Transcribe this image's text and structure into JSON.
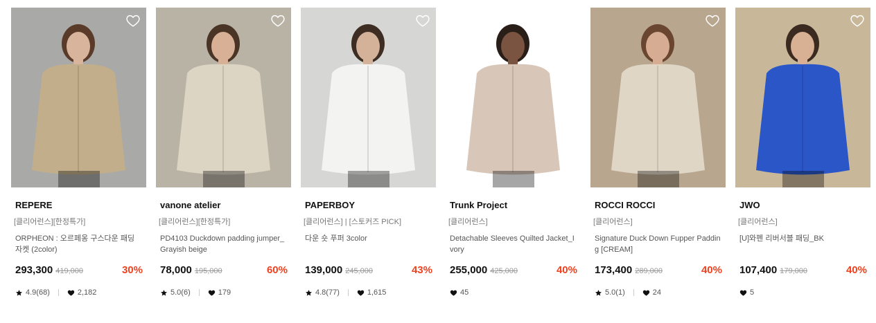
{
  "products": [
    {
      "brand": "REPERE",
      "tags": "[클리어런스][한정특가]",
      "name": "ORPHEON : 오르페옹 구스다운 패딩 자켓 (2color)",
      "price": "293,300",
      "original_price": "419,000",
      "discount": "30%",
      "rating": "4.9(68)",
      "likes": "2,182",
      "photo_colors": {
        "bg": "#a9a9a7",
        "coat": "#c2ae8a",
        "skin": "#d8b49c",
        "hair": "#5a3a28"
      }
    },
    {
      "brand": "vanone atelier",
      "tags": "[클리어런스][한정특가]",
      "name": "PD4103 Duckdown padding jumper_Grayish beige",
      "price": "78,000",
      "original_price": "195,000",
      "discount": "60%",
      "rating": "5.0(6)",
      "likes": "179",
      "photo_colors": {
        "bg": "#b9b3a6",
        "coat": "#dcd5c4",
        "skin": "#d7b096",
        "hair": "#4a3426"
      }
    },
    {
      "brand": "PAPERBOY",
      "tags": "[클리어런스] | [스토커즈 PICK]",
      "name": "다운 숏 푸퍼 3color",
      "price": "139,000",
      "original_price": "245,000",
      "discount": "43%",
      "rating": "4.8(77)",
      "likes": "1,615",
      "photo_colors": {
        "bg": "#d6d6d4",
        "coat": "#f3f3f1",
        "skin": "#d4b29a",
        "hair": "#3d2d22"
      }
    },
    {
      "brand": "Trunk Project",
      "tags": "[클리어런스]",
      "name": "Detachable Sleeves Quilted Jacket_Ivory",
      "price": "255,000",
      "original_price": "425,000",
      "discount": "40%",
      "rating": "",
      "likes": "45",
      "photo_colors": {
        "bg": "#ffffff",
        "coat": "#d8c6b8",
        "skin": "#7a5440",
        "hair": "#2a1e18"
      }
    },
    {
      "brand": "ROCCI ROCCI",
      "tags": "[클리어런스]",
      "name": "Signature Duck Down Fupper Padding [CREAM]",
      "price": "173,400",
      "original_price": "289,000",
      "discount": "40%",
      "rating": "5.0(1)",
      "likes": "24",
      "photo_colors": {
        "bg": "#b8a68e",
        "coat": "#e0d6c6",
        "skin": "#d6ad92",
        "hair": "#6a4530"
      }
    },
    {
      "brand": "JWO",
      "tags": "[클리어런스]",
      "name": "[U]와펜 리버서블 패딩_BK",
      "price": "107,400",
      "original_price": "179,000",
      "discount": "40%",
      "rating": "",
      "likes": "5",
      "photo_colors": {
        "bg": "#c9b79a",
        "coat": "#2a56c8",
        "skin": "#d8b094",
        "hair": "#3a2a20"
      }
    }
  ],
  "colors": {
    "discount": "#f0411f",
    "strike": "#999999"
  },
  "icons": {
    "wishlist": "heart-outline-icon",
    "rating": "star-icon",
    "likes": "heart-filled-icon"
  }
}
